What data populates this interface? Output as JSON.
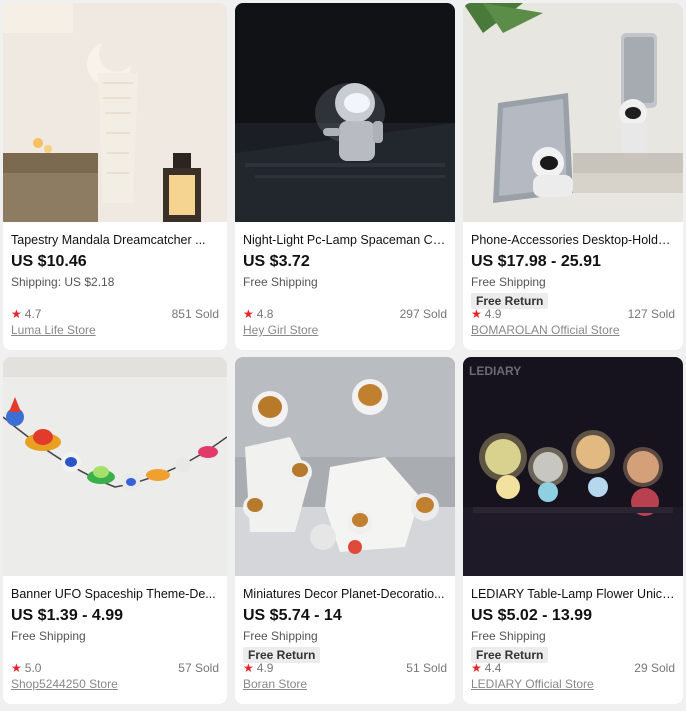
{
  "products": [
    {
      "title": "Tapestry Mandala Dreamcatcher ...",
      "price": "US $10.46",
      "shipping": "Shipping: US $2.18",
      "badge": "",
      "rating": "4.7",
      "sold": "851 Sold",
      "store": "Luma Life Store"
    },
    {
      "title": "Night-Light Pc-Lamp Spaceman Co...",
      "price": "US $3.72",
      "shipping": "Free Shipping",
      "badge": "",
      "rating": "4.8",
      "sold": "297 Sold",
      "store": "Hey Girl Store"
    },
    {
      "title": "Phone-Accessories Desktop-Holde...",
      "price": "US $17.98 - 25.91",
      "shipping": "Free Shipping",
      "badge": "Free Return",
      "rating": "4.9",
      "sold": "127 Sold",
      "store": "BOMAROLAN Official Store"
    },
    {
      "title": "Banner UFO Spaceship Theme-De...",
      "price": "US $1.39 - 4.99",
      "shipping": "Free Shipping",
      "badge": "",
      "rating": "5.0",
      "sold": "57 Sold",
      "store": "Shop5244250 Store"
    },
    {
      "title": "Miniatures Decor Planet-Decoratio...",
      "price": "US $5.74 - 14",
      "shipping": "Free Shipping",
      "badge": "Free Return",
      "rating": "4.9",
      "sold": "51 Sold",
      "store": "Boran Store"
    },
    {
      "title": "LEDIARY Table-Lamp Flower Unico...",
      "price": "US $5.02 - 13.99",
      "shipping": "Free Shipping",
      "badge": "Free Return",
      "rating": "4.4",
      "sold": "29 Sold",
      "store": "LEDIARY Official Store"
    }
  ],
  "images": [
    {
      "icon": "dreamcatcher-photo",
      "watermark": ""
    },
    {
      "icon": "spaceman-lamp-photo",
      "watermark": ""
    },
    {
      "icon": "astronaut-phone-holder-photo",
      "watermark": ""
    },
    {
      "icon": "ufo-banner-photo",
      "watermark": ""
    },
    {
      "icon": "astronaut-figurines-photo",
      "watermark": ""
    },
    {
      "icon": "astronaut-lamps-photo",
      "watermark": "LEDIARY"
    }
  ],
  "colors": {
    "star": "#e8232a",
    "background": "#f0f0f0",
    "card": "#ffffff"
  }
}
